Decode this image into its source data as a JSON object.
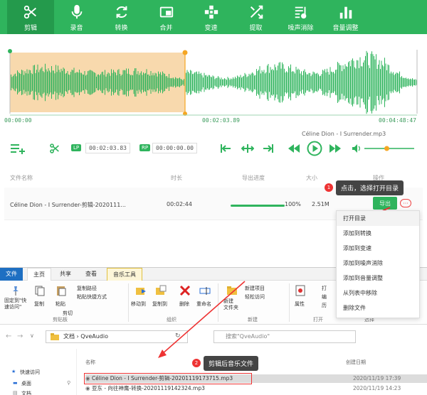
{
  "toolbar": {
    "items": [
      {
        "label": "剪辑",
        "icon": "scissors-icon"
      },
      {
        "label": "录音",
        "icon": "microphone-icon"
      },
      {
        "label": "转换",
        "icon": "convert-icon"
      },
      {
        "label": "合并",
        "icon": "merge-icon"
      },
      {
        "label": "变速",
        "icon": "speed-icon"
      },
      {
        "label": "提取",
        "icon": "extract-icon"
      },
      {
        "label": "噪声消除",
        "icon": "noise-icon"
      },
      {
        "label": "音量调整",
        "icon": "volume-icon"
      }
    ],
    "active_index": 0,
    "colors": {
      "bg": "#2fb45d",
      "active": "#249a4c"
    }
  },
  "waveform": {
    "time_start": "00:00:00",
    "time_marker": "00:02:03.89",
    "time_end": "00:04:48:47",
    "track_name": "Céline Dion - I Surrender.mp3",
    "selected_fraction": 0.43,
    "colors": {
      "wave": "#2fb45d",
      "selection": "#f8d9ad",
      "marker": "#f5a623"
    }
  },
  "controls": {
    "lp_label": "LP",
    "lp_time": "00:02:03.83",
    "rp_label": "RP",
    "rp_time": "00:00:00.00",
    "volume_fraction": 0.45
  },
  "list": {
    "headers": {
      "name": "文件名称",
      "duration": "时长",
      "progress": "导出进度",
      "size": "大小",
      "action": "操作"
    },
    "row": {
      "name": "Céline Dion - I Surrender-剪辑-2020111...",
      "duration": "00:02:44",
      "progress_text": "100%",
      "progress_value": 1.0,
      "size": "2.51M",
      "export_label": "导出",
      "more_label": "···"
    }
  },
  "callouts": {
    "tip1_num": "1",
    "tip1_text": "点击，选择打开目录",
    "tip2_num": "2",
    "tip2_text": "剪辑后音乐文件"
  },
  "context_menu": {
    "items": [
      "打开目录",
      "添加到转换",
      "添加到变速",
      "添加到噪声消除",
      "添加到音量调整",
      "从列表中移除",
      "删除文件"
    ]
  },
  "explorer": {
    "tabs": [
      "文件",
      "主页",
      "共享",
      "查看",
      "音乐工具"
    ],
    "ribbon": {
      "pin": "固定到\"快\n速访问\"",
      "copy": "复制",
      "paste": "粘贴",
      "copy_path": "复制路径",
      "paste_shortcut": "粘贴快捷方式",
      "cut": "剪切",
      "clipboard_group": "剪贴板",
      "move_to": "移动到",
      "copy_to": "复制到",
      "delete": "删除",
      "rename": "重命名",
      "organize_group": "组织",
      "new_folder": "新建\n文件夹",
      "new_item": "新建项目",
      "easy_access": "轻松访问",
      "new_group": "新建",
      "properties": "属性",
      "open": "打",
      "edit": "编",
      "history": "历",
      "open_group": "打开",
      "select_group": "选择"
    },
    "address": {
      "root": "文档",
      "folder": "QveAudio",
      "search_placeholder": "搜索\"QveAudio\""
    },
    "nav": {
      "quick_access": "快速访问",
      "desktop": "桌面",
      "docs": "文档"
    },
    "columns": {
      "name": "名称",
      "date": "创建日期"
    },
    "files": [
      {
        "name": "Céline Dion - I Surrender-剪辑-20201119173715.mp3",
        "date": "2020/11/19 17:39"
      },
      {
        "name": "亚东 - 向往神鹰-转换-20201119142324.mp3",
        "date": "2020/11/19 14:23"
      }
    ]
  }
}
